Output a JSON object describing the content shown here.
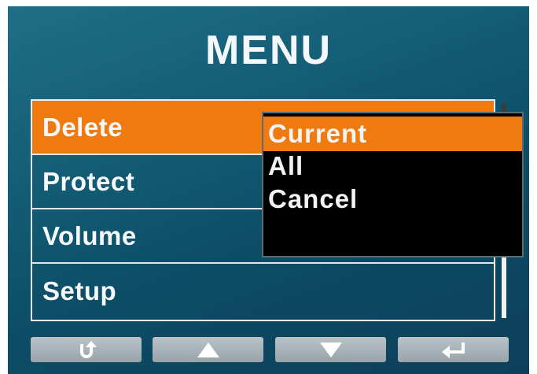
{
  "title": "MENU",
  "menu": {
    "items": [
      {
        "label": "Delete",
        "selected": true
      },
      {
        "label": "Protect",
        "selected": false
      },
      {
        "label": "Volume",
        "selected": false
      },
      {
        "label": "Setup",
        "selected": false
      }
    ]
  },
  "popup": {
    "items": [
      {
        "label": "Current",
        "selected": true
      },
      {
        "label": "All",
        "selected": false
      },
      {
        "label": "Cancel",
        "selected": false
      }
    ]
  },
  "buttons": [
    {
      "icon": "back-arrow-icon"
    },
    {
      "icon": "up-arrow-icon"
    },
    {
      "icon": "down-arrow-icon"
    },
    {
      "icon": "enter-icon"
    }
  ],
  "colors": {
    "accent": "#ef7b10",
    "background": "#125a73",
    "popup_bg": "#000000",
    "text": "#f6f9fb"
  }
}
